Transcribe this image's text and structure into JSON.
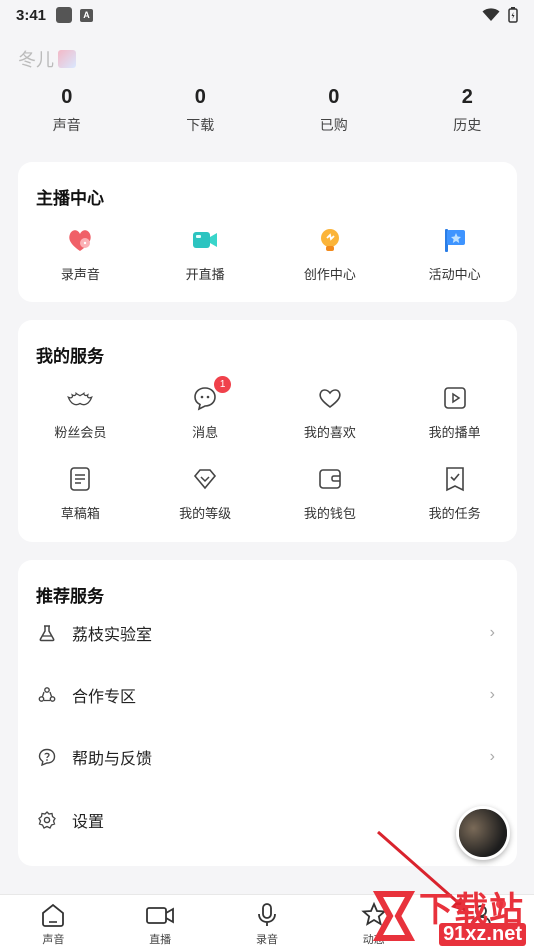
{
  "status_bar": {
    "time": "3:41",
    "a_label": "A"
  },
  "profile": {
    "username": "冬儿"
  },
  "stats": [
    {
      "value": "0",
      "label": "声音"
    },
    {
      "value": "0",
      "label": "下载"
    },
    {
      "value": "0",
      "label": "已购"
    },
    {
      "value": "2",
      "label": "历史"
    }
  ],
  "anchor_center": {
    "title": "主播中心",
    "items": [
      {
        "label": "录声音",
        "icon": "mic-heart-icon"
      },
      {
        "label": "开直播",
        "icon": "camera-icon"
      },
      {
        "label": "创作中心",
        "icon": "bulb-icon"
      },
      {
        "label": "活动中心",
        "icon": "flag-star-icon"
      }
    ]
  },
  "my_services": {
    "title": "我的服务",
    "row1": [
      {
        "label": "粉丝会员",
        "icon": "wings-icon"
      },
      {
        "label": "消息",
        "icon": "chat-bubble-icon",
        "badge": "1"
      },
      {
        "label": "我的喜欢",
        "icon": "heart-icon"
      },
      {
        "label": "我的播单",
        "icon": "play-list-icon"
      }
    ],
    "row2": [
      {
        "label": "草稿箱",
        "icon": "draft-icon"
      },
      {
        "label": "我的等级",
        "icon": "diamond-icon"
      },
      {
        "label": "我的钱包",
        "icon": "wallet-icon"
      },
      {
        "label": "我的任务",
        "icon": "task-icon"
      }
    ]
  },
  "recommended": {
    "title": "推荐服务",
    "items": [
      {
        "label": "荔枝实验室",
        "icon": "flask-icon"
      },
      {
        "label": "合作专区",
        "icon": "cooperation-icon"
      },
      {
        "label": "帮助与反馈",
        "icon": "help-icon"
      },
      {
        "label": "设置",
        "icon": "gear-icon"
      }
    ]
  },
  "tabbar": [
    {
      "label": "声音",
      "icon": "home-icon"
    },
    {
      "label": "直播",
      "icon": "video-icon"
    },
    {
      "label": "录音",
      "icon": "mic-icon"
    },
    {
      "label": "动态",
      "icon": "star-icon"
    },
    {
      "label": "",
      "icon": "profile-icon"
    }
  ],
  "watermark": {
    "site_text": "下载站",
    "url": "91xz.net"
  },
  "colors": {
    "accent": "#f0414b",
    "background": "#f5f5f7",
    "card": "#ffffff"
  }
}
